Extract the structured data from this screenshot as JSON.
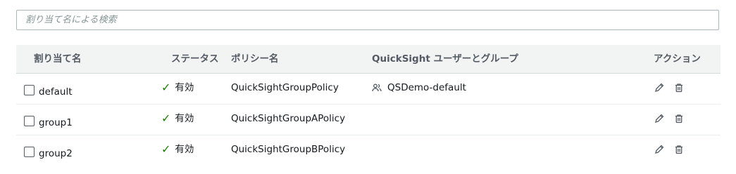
{
  "search": {
    "placeholder": "割り当て名による検索",
    "value": ""
  },
  "table": {
    "headers": {
      "assignment_name": "割り当て名",
      "status": "ステータス",
      "policy_name": "ポリシー名",
      "quicksight": "QuickSight ユーザーとグループ",
      "actions": "アクション"
    },
    "rows": [
      {
        "name": "default",
        "status": "有効",
        "policy": "QuickSightGroupPolicy",
        "quicksight": "QSDemo-default"
      },
      {
        "name": "group1",
        "status": "有効",
        "policy": "QuickSightGroupAPolicy",
        "quicksight": ""
      },
      {
        "name": "group2",
        "status": "有効",
        "policy": "QuickSightGroupBPolicy",
        "quicksight": ""
      }
    ]
  },
  "icons": {
    "status": "check-icon",
    "quicksight": "group-icon",
    "edit": "pencil-icon",
    "delete": "trash-icon"
  },
  "colors": {
    "status_ok": "#1d8102",
    "header_bg": "#f2f3f3",
    "border": "#aab7b8"
  }
}
